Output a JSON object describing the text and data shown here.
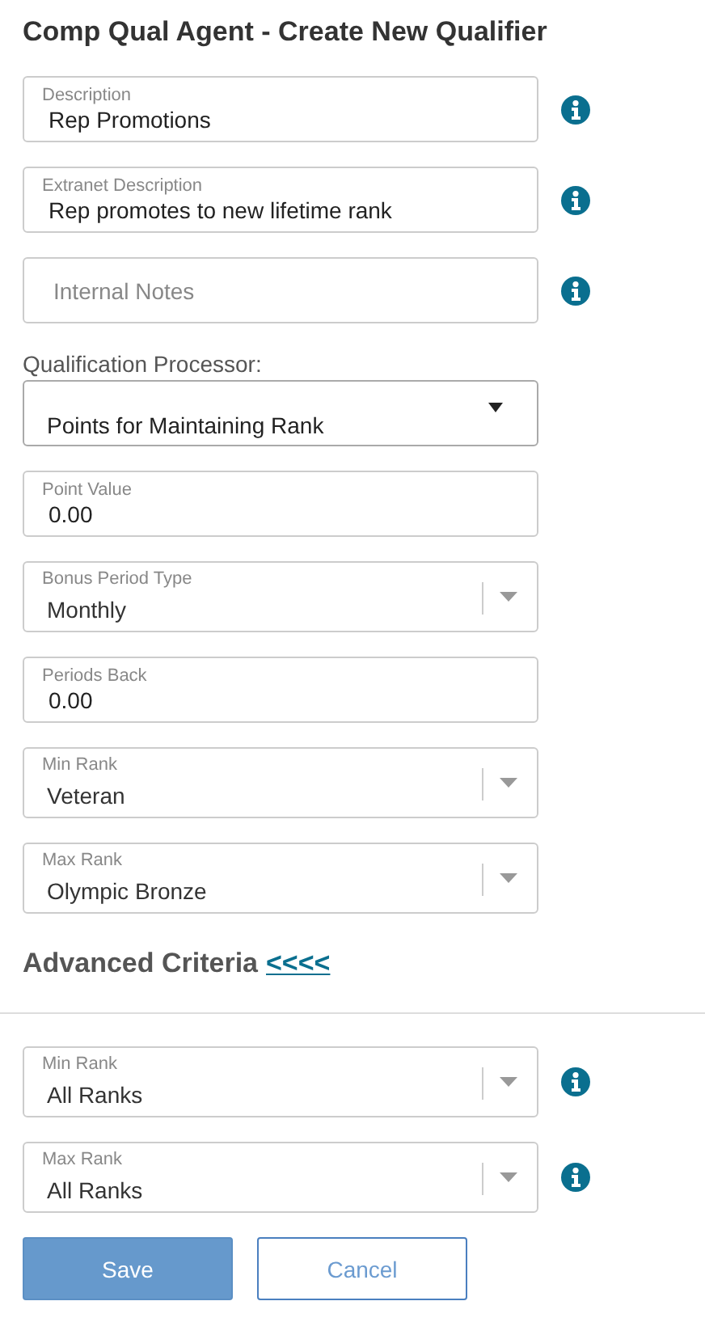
{
  "title": "Comp Qual Agent - Create New Qualifier",
  "fields": [
    {
      "kind": "text",
      "label": "Description",
      "value": "Rep Promotions",
      "info": true
    },
    {
      "kind": "text",
      "label": "Extranet Description",
      "value": "Rep promotes to new lifetime rank",
      "info": true
    },
    {
      "kind": "text",
      "placeholder": "Internal Notes",
      "info": true
    },
    {
      "kind": "native_select",
      "label": "Qualification Processor:",
      "value": "Points for Maintaining Rank",
      "info": false
    },
    {
      "kind": "text",
      "label": "Point Value",
      "value": "0.00",
      "info": false
    },
    {
      "kind": "select",
      "label": "Bonus Period Type",
      "value": "Monthly",
      "info": false
    },
    {
      "kind": "text",
      "label": "Periods Back",
      "value": "0.00",
      "info": false
    },
    {
      "kind": "select",
      "label": "Min Rank",
      "value": "Veteran",
      "info": false
    },
    {
      "kind": "select",
      "label": "Max Rank",
      "value": "Olympic Bronze",
      "info": false
    }
  ],
  "advanced": {
    "title": "Advanced Criteria",
    "toggle": "<<<<",
    "fields": [
      {
        "kind": "select",
        "label": "Min Rank",
        "value": "All Ranks",
        "info": true
      },
      {
        "kind": "select",
        "label": "Max Rank",
        "value": "All Ranks",
        "info": true
      }
    ]
  },
  "buttons": [
    {
      "label": "Save",
      "kind": "primary"
    },
    {
      "label": "Cancel",
      "kind": "secondary"
    }
  ]
}
